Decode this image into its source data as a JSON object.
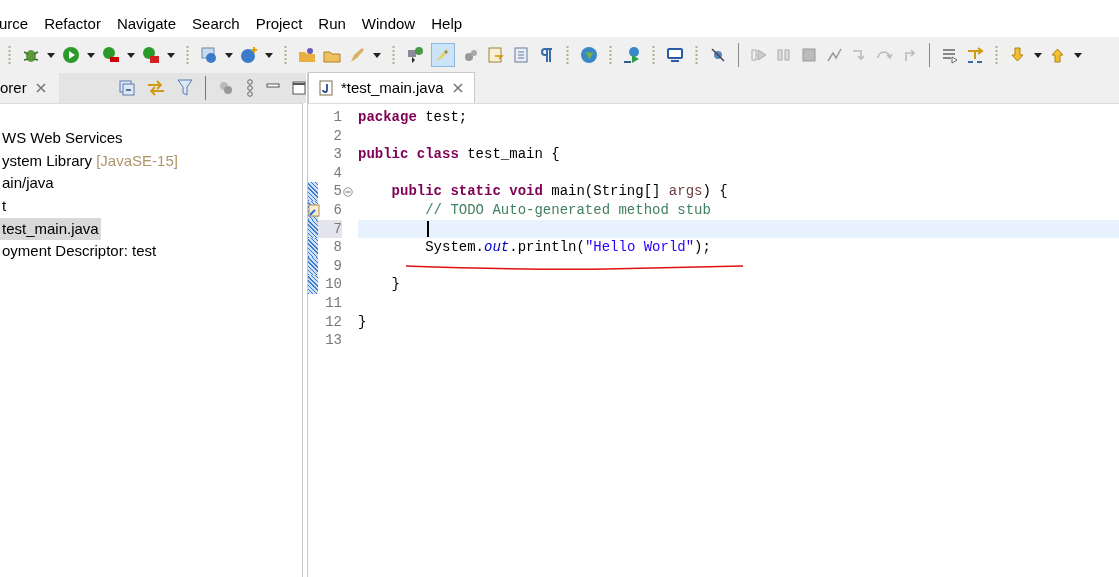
{
  "menu": [
    "urce",
    "Refactor",
    "Navigate",
    "Search",
    "Project",
    "Run",
    "Window",
    "Help"
  ],
  "explorer": {
    "tab_label": "orer",
    "tree": [
      {
        "label": "WS Web Services",
        "selected": false
      },
      {
        "label": "ystem Library",
        "decoration": "[JavaSE-15]",
        "selected": false
      },
      {
        "label": "ain/java",
        "selected": false
      },
      {
        "label": "t",
        "selected": false
      },
      {
        "label": "test_main.java",
        "selected": true
      },
      {
        "label": "oyment Descriptor: test",
        "selected": false
      }
    ]
  },
  "editor": {
    "tab": {
      "label": "*test_main.java",
      "selected": true
    },
    "lines": [
      {
        "number": "1",
        "changed": false,
        "foldable": false,
        "task_marker": false,
        "selected": false,
        "tokens": [
          {
            "kind": "keyword",
            "text": "package "
          },
          {
            "kind": "plain",
            "text": "test;"
          }
        ]
      },
      {
        "number": "2",
        "changed": false,
        "foldable": false,
        "task_marker": false,
        "selected": false
      },
      {
        "number": "3",
        "changed": false,
        "foldable": false,
        "task_marker": false,
        "selected": false,
        "tokens": [
          {
            "kind": "keyword",
            "text": "public class "
          },
          {
            "kind": "plain",
            "text": "test_main {"
          }
        ]
      },
      {
        "number": "4",
        "changed": false,
        "foldable": false,
        "task_marker": false,
        "selected": false
      },
      {
        "number": "5",
        "changed": true,
        "foldable": true,
        "task_marker": false,
        "selected": false,
        "tokens": [
          {
            "kind": "keyword",
            "text": "    public static void "
          },
          {
            "kind": "plain",
            "text": "main(String[] "
          },
          {
            "kind": "param",
            "text": "args"
          },
          {
            "kind": "plain",
            "text": ") {"
          }
        ]
      },
      {
        "number": "6",
        "changed": true,
        "foldable": false,
        "task_marker": true,
        "selected": false,
        "tokens": [
          {
            "kind": "comment",
            "text": "        // TODO Auto-generated method stub"
          }
        ]
      },
      {
        "number": "7",
        "changed": true,
        "foldable": false,
        "task_marker": false,
        "selected": true
      },
      {
        "number": "8",
        "changed": true,
        "foldable": false,
        "task_marker": false,
        "selected": false,
        "tokens": [
          {
            "kind": "plain",
            "text": "        System."
          },
          {
            "kind": "field",
            "text": "out"
          },
          {
            "kind": "plain",
            "text": ".println("
          },
          {
            "kind": "string",
            "text": "\"Hello World\""
          },
          {
            "kind": "plain",
            "text": ");"
          }
        ]
      },
      {
        "number": "9",
        "changed": true,
        "foldable": false,
        "task_marker": false,
        "selected": false
      },
      {
        "number": "10",
        "changed": true,
        "foldable": false,
        "task_marker": false,
        "selected": false,
        "tokens": [
          {
            "kind": "plain",
            "text": "    }"
          }
        ]
      },
      {
        "number": "11",
        "changed": false,
        "foldable": false,
        "task_marker": false,
        "selected": false
      },
      {
        "number": "12",
        "changed": false,
        "foldable": false,
        "task_marker": false,
        "selected": false,
        "tokens": [
          {
            "kind": "plain",
            "text": "}"
          }
        ]
      },
      {
        "number": "13",
        "changed": false,
        "foldable": false,
        "task_marker": false,
        "selected": false
      }
    ]
  }
}
